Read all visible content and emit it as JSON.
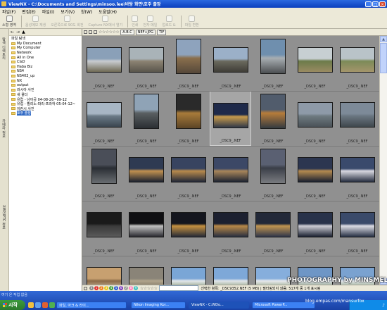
{
  "window": {
    "title": "ViewNX - C:\\Documents and Settings\\minsoo.lee\\바탕 화면\\호주 출장"
  },
  "menu": [
    "파일(F)",
    "편집(E)",
    "파일(I)",
    "보기(V)",
    "창(W)",
    "도움말(H)"
  ],
  "toolbar": {
    "buttons": [
      {
        "label": "소형 영역",
        "enabled": true
      },
      {
        "label": "음성메모 재생",
        "enabled": false
      },
      {
        "label": "오른쪽으로 90도 회전",
        "enabled": false
      },
      {
        "label": "Capture NX에서 열기",
        "enabled": false
      },
      {
        "label": "인쇄",
        "enabled": false
      },
      {
        "label": "전자 메일",
        "enabled": false
      },
      {
        "label": "업로드 &",
        "enabled": false
      },
      {
        "label": "파일 변환",
        "enabled": false
      }
    ]
  },
  "side_tabs": [
    "탐색 디렉토리",
    "카메라 정보",
    "XMP/IPTC 정보"
  ],
  "folder_tree": {
    "header": "파일 탐색",
    "items": [
      {
        "label": "My Document",
        "selected": false
      },
      {
        "label": "My Computer",
        "selected": false
      },
      {
        "label": "Network",
        "selected": false
      },
      {
        "label": "All in One",
        "selected": false
      },
      {
        "label": "CIsD",
        "selected": false
      },
      {
        "label": "Haba Biz",
        "selected": false
      },
      {
        "label": "NS4",
        "selected": false
      },
      {
        "label": "NS402_up",
        "selected": false
      },
      {
        "label": "NX",
        "selected": false
      },
      {
        "label": "output",
        "selected": false
      },
      {
        "label": "러시아 사진",
        "selected": false
      },
      {
        "label": "새 폴더",
        "selected": false
      },
      {
        "label": "유럽 - 남아공 04-08-26~09-12",
        "selected": false
      },
      {
        "label": "유럽 - 필리노-파리-프라하 05-04-12~",
        "selected": false
      },
      {
        "label": "이란시 사진",
        "selected": false
      },
      {
        "label": "호주 출장",
        "selected": true
      }
    ]
  },
  "filter": {
    "format_label": "NEF+JPG",
    "tif_label": "TIF",
    "abc_label": "A.B.C"
  },
  "thumbnails": [
    {
      "caption": "_DSC9_.NEF",
      "palette": [
        "#8aa0b8",
        "#c9ccd0",
        "#6f6a55"
      ],
      "selected": false
    },
    {
      "caption": "_DSC9_.NEF",
      "palette": [
        "#a9b3b8",
        "#8c8373",
        "#5a564c"
      ],
      "selected": false
    },
    {
      "caption": "_DSC9_.NEF",
      "palette": [
        "#8ea3bd",
        "#8a6f4d",
        "#55483a"
      ],
      "selected": false
    },
    {
      "caption": "_DSC9_.NEF",
      "palette": [
        "#9bb0c8",
        "#6b6a5e",
        "#3f3d37"
      ],
      "selected": false
    },
    {
      "caption": "_DSC9_.NEF",
      "palette": [
        "#6f8fae",
        "#a8aeb2",
        "#4c4f52"
      ],
      "selected": false
    },
    {
      "caption": "_DSC9_.NEF",
      "palette": [
        "#c7cfd2",
        "#6c7b4a",
        "#9a8a62"
      ],
      "selected": false
    },
    {
      "caption": "_DSC9_.NEF",
      "palette": [
        "#b9c3c8",
        "#7c8a58",
        "#a4956b"
      ],
      "selected": false
    },
    {
      "caption": "_DSC9_.NEF",
      "palette": [
        "#a7b6c4",
        "#6a7a86",
        "#3b4650"
      ],
      "selected": false
    },
    {
      "caption": "_DSC9_.NEF",
      "palette": [
        "#8fa3b6",
        "#5a5f62",
        "#2a2e32"
      ],
      "selected": false
    },
    {
      "caption": "_DSC9_.NEF",
      "palette": [
        "#2a2a2a",
        "#a87b3a",
        "#5b4426"
      ],
      "selected": false
    },
    {
      "caption": "_DSC9_.NEF",
      "palette": [
        "#1f2a4a",
        "#c69a4c",
        "#303848"
      ],
      "selected": true
    },
    {
      "caption": "_DSC9_.NEF",
      "palette": [
        "#515c6c",
        "#b77c3a",
        "#343a40"
      ],
      "selected": false
    },
    {
      "caption": "_DSC9_.NEF",
      "palette": [
        "#8e9aa8",
        "#6e7a80",
        "#4a5258"
      ],
      "selected": false
    },
    {
      "caption": "_DSC9_.NEF",
      "palette": [
        "#7d8a98",
        "#6a7680",
        "#3f474d"
      ],
      "selected": false
    },
    {
      "caption": "_DSC9_.NEF",
      "palette": [
        "#4a4e58",
        "#2a2e34",
        "#6a6e72"
      ],
      "selected": false
    },
    {
      "caption": "_DSC9_.NEF",
      "palette": [
        "#2e3a52",
        "#c09050",
        "#1c2230"
      ],
      "selected": false
    },
    {
      "caption": "_DSC9_.NEF",
      "palette": [
        "#384460",
        "#b88a4c",
        "#222838"
      ],
      "selected": false
    },
    {
      "caption": "_DSC9_.NEF",
      "palette": [
        "#3c4866",
        "#a8865a",
        "#1e2432"
      ],
      "selected": false
    },
    {
      "caption": "_DSC9_.NEF",
      "palette": [
        "#5a6072",
        "#3a3e48",
        "#7a7c80"
      ],
      "selected": false
    },
    {
      "caption": "_DSC9_.NEF",
      "palette": [
        "#2c3650",
        "#b48a50",
        "#1a2030"
      ],
      "selected": false
    },
    {
      "caption": "_DSC9_.NEF",
      "palette": [
        "#3a4a6c",
        "#d8d8e0",
        "#262e40"
      ],
      "selected": false
    },
    {
      "caption": "_DSC9_.NEF",
      "palette": [
        "#1a1a1a",
        "#3a3a3a",
        "#5a5a5a"
      ],
      "selected": false
    },
    {
      "caption": "_DSC9_.NEF",
      "palette": [
        "#0f0f12",
        "#c0c0c0",
        "#2a2a30"
      ],
      "selected": false
    },
    {
      "caption": "_DSC9_.NEF",
      "palette": [
        "#14161e",
        "#c49040",
        "#262a36"
      ],
      "selected": false
    },
    {
      "caption": "_DSC9_.NEF",
      "palette": [
        "#1c2030",
        "#b88848",
        "#2a3040"
      ],
      "selected": false
    },
    {
      "caption": "_DSC9_.NEF",
      "palette": [
        "#222838",
        "#c09450",
        "#30364a"
      ],
      "selected": false
    },
    {
      "caption": "_DSC9_.NEF",
      "palette": [
        "#28324a",
        "#ccccd4",
        "#1a2030"
      ],
      "selected": false
    },
    {
      "caption": "_DSC9_.NEF",
      "palette": [
        "#3a4a6a",
        "#dcdce4",
        "#263044"
      ],
      "selected": false
    },
    {
      "caption": "_DSC9_.NEF",
      "palette": [
        "#c7a070",
        "#8a6a48",
        "#e4d2b4"
      ],
      "selected": false
    },
    {
      "caption": "_DSC9_.NEF",
      "palette": [
        "#8a8478",
        "#b0a48c",
        "#5c5446"
      ],
      "selected": false
    },
    {
      "caption": "_DSC9_.NEF",
      "palette": [
        "#7aa6d6",
        "#e2e6ea",
        "#5e7a44"
      ],
      "selected": false
    },
    {
      "caption": "_DSC9_.NEF",
      "palette": [
        "#7ea8d8",
        "#e0e4e8",
        "#66804a"
      ],
      "selected": false
    },
    {
      "caption": "_DSC9_.NEF",
      "palette": [
        "#86aedc",
        "#e6e8ec",
        "#6a8450"
      ],
      "selected": false
    },
    {
      "caption": "_DSC9_.NEF",
      "palette": [
        "#6e96c6",
        "#d6dce2",
        "#5a7440"
      ],
      "selected": false
    },
    {
      "caption": "_DSC9_.NEF",
      "palette": [
        "#7aa2d0",
        "#dfe3e8",
        "#62804a"
      ],
      "selected": false
    }
  ],
  "status": {
    "selection_text": "선택한 항목: _DSC9352.NEF (5 MB) | 필터링되지 않음: 517개 중 1개 표시됨",
    "label_numbers": [
      "0",
      "1",
      "2",
      "3",
      "4",
      "5",
      "6",
      "7",
      "8",
      "9"
    ],
    "label_colors": [
      "#888888",
      "#e03030",
      "#f08020",
      "#e8c820",
      "#40a040",
      "#3060d0",
      "#8040c0",
      "#a0a0a0",
      "#ff80c0",
      "#40c0c0"
    ]
  },
  "taskbar": {
    "start_label": "시작",
    "tray_label": "여기 온 작업 없음",
    "quick_colors": [
      "#f0c040",
      "#60a0f0",
      "#e06030",
      "#50b050"
    ],
    "tasks": [
      {
        "label": "파일, 아크 & 라이...",
        "active": false
      },
      {
        "label": "Nikon Imaging Kor...",
        "active": false
      },
      {
        "label": "ViewNX - C:WDo...",
        "active": true
      },
      {
        "label": "Microsoft PowerP...",
        "active": false
      }
    ]
  },
  "watermark": {
    "line1": "PHOTOGRAPHY by MINSMEL",
    "line2": "blog.empas.com/mansurfox"
  }
}
